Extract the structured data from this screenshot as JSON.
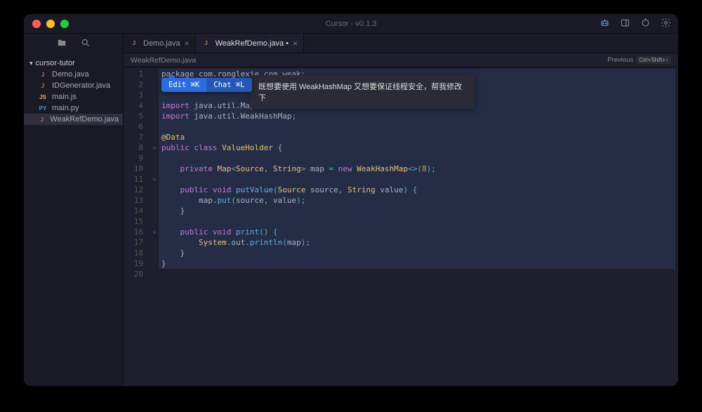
{
  "window": {
    "title": "Cursor - v0.1.3"
  },
  "titlebar_icons": [
    "robot-icon",
    "panel-icon",
    "refresh-icon",
    "gear-icon"
  ],
  "sidebar": {
    "folder": "cursor-tutor",
    "items": [
      {
        "name": "Demo.java",
        "badge": "J",
        "badgeClass": "badge-java",
        "active": false
      },
      {
        "name": "IDGenerator.java",
        "badge": "J",
        "badgeClass": "badge-java",
        "active": false
      },
      {
        "name": "main.js",
        "badge": "JS",
        "badgeClass": "badge-js",
        "active": false
      },
      {
        "name": "main.py",
        "badge": "PY",
        "badgeClass": "badge-py",
        "active": false
      },
      {
        "name": "WeakRefDemo.java",
        "badge": "J",
        "badgeClass": "badge-java",
        "active": true
      }
    ]
  },
  "tabs": [
    {
      "label": "Demo.java",
      "badge": "J",
      "active": false,
      "dirty": false
    },
    {
      "label": "WeakRefDemo.java",
      "badge": "J",
      "active": true,
      "dirty": true
    }
  ],
  "breadcrumb": "WeakRefDemo.java",
  "previous": {
    "label": "Previous",
    "key": "Ctrl+Shift+↑"
  },
  "tooltip": {
    "edit": "Edit ⌘K",
    "chat": "Chat ⌘L"
  },
  "chat_prompt": "既想要使用 WeakHashMap 又想要保证线程安全，帮我修改下",
  "code": {
    "lines": 20,
    "fold_marks": {
      "8": "v",
      "11": "v",
      "16": "v"
    },
    "tokens": [
      [
        [
          "pkg",
          "package "
        ],
        [
          "id",
          "com.ronglexie.com.weak"
        ],
        [
          "op",
          ";"
        ]
      ],
      [
        [
          "op",
          ";"
        ]
      ],
      [],
      [
        [
          "kw",
          "import "
        ],
        [
          "id",
          "java.util.Map"
        ],
        [
          "op",
          ";"
        ]
      ],
      [
        [
          "kw",
          "import "
        ],
        [
          "id",
          "java.util.WeakHashMap"
        ],
        [
          "op",
          ";"
        ]
      ],
      [],
      [
        [
          "ann",
          "@Data"
        ]
      ],
      [
        [
          "kw",
          "public class "
        ],
        [
          "type",
          "ValueHolder"
        ],
        [
          "id",
          " {"
        ]
      ],
      [],
      [
        [
          "id",
          "    "
        ],
        [
          "kw",
          "private "
        ],
        [
          "type",
          "Map"
        ],
        [
          "op",
          "<"
        ],
        [
          "type",
          "Source"
        ],
        [
          "op",
          ", "
        ],
        [
          "type",
          "String"
        ],
        [
          "op",
          "> "
        ],
        [
          "id",
          "map"
        ],
        [
          "op",
          " = "
        ],
        [
          "kw",
          "new "
        ],
        [
          "type",
          "WeakHashMap"
        ],
        [
          "op",
          "<>("
        ],
        [
          "num",
          "8"
        ],
        [
          "op",
          ");"
        ]
      ],
      [],
      [
        [
          "id",
          "    "
        ],
        [
          "kw",
          "public void "
        ],
        [
          "fn",
          "putValue"
        ],
        [
          "op",
          "("
        ],
        [
          "type",
          "Source"
        ],
        [
          "id",
          " source"
        ],
        [
          "op",
          ", "
        ],
        [
          "type",
          "String"
        ],
        [
          "id",
          " value"
        ],
        [
          "op",
          ") {"
        ]
      ],
      [
        [
          "id",
          "        map."
        ],
        [
          "fn",
          "put"
        ],
        [
          "op",
          "("
        ],
        [
          "id",
          "source"
        ],
        [
          "op",
          ", "
        ],
        [
          "id",
          "value"
        ],
        [
          "op",
          ");"
        ]
      ],
      [
        [
          "id",
          "    }"
        ]
      ],
      [],
      [
        [
          "id",
          "    "
        ],
        [
          "kw",
          "public void "
        ],
        [
          "fn",
          "print"
        ],
        [
          "op",
          "() {"
        ]
      ],
      [
        [
          "id",
          "        "
        ],
        [
          "type",
          "System"
        ],
        [
          "op",
          "."
        ],
        [
          "id",
          "out"
        ],
        [
          "op",
          "."
        ],
        [
          "fn",
          "println"
        ],
        [
          "op",
          "("
        ],
        [
          "id",
          "map"
        ],
        [
          "op",
          ");"
        ]
      ],
      [
        [
          "id",
          "    }"
        ]
      ],
      [
        [
          "id",
          "}"
        ]
      ],
      []
    ]
  }
}
